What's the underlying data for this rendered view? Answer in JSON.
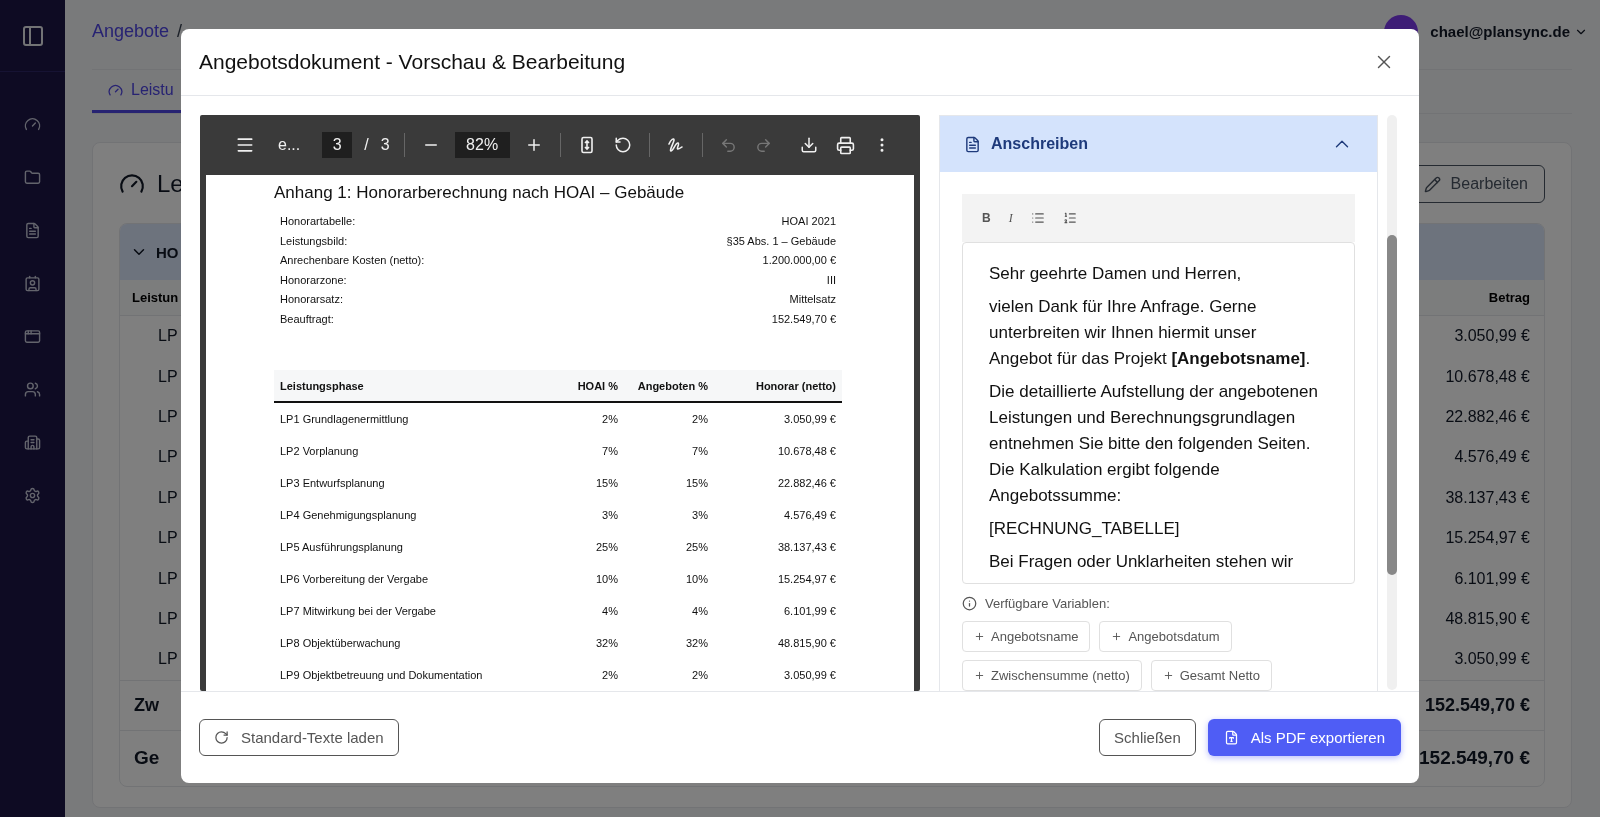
{
  "header": {
    "breadcrumb": "Angebote",
    "breadcrumb_separator": "/",
    "user_email": "chael@plansync.de"
  },
  "tabs": [
    {
      "label": "Leistu",
      "selected": true
    }
  ],
  "card": {
    "title": "Le",
    "edit_button": "Bearbeiten",
    "group": {
      "label": "HO",
      "expanded": true
    },
    "columns": [
      "Leistun",
      "Betrag"
    ],
    "rows": [
      {
        "phase": "LP",
        "amount": "3.050,99 €"
      },
      {
        "phase": "LP",
        "amount": "10.678,48 €"
      },
      {
        "phase": "LP",
        "amount": "22.882,46 €"
      },
      {
        "phase": "LP",
        "amount": "4.576,49 €"
      },
      {
        "phase": "LP",
        "amount": "38.137,43 €"
      },
      {
        "phase": "LP",
        "amount": "15.254,97 €"
      },
      {
        "phase": "LP",
        "amount": "6.101,99 €"
      },
      {
        "phase": "LP",
        "amount": "48.815,90 €"
      },
      {
        "phase": "LP",
        "amount": "3.050,99 €"
      }
    ],
    "subtotal": {
      "label": "Zw",
      "amount": "152.549,70 €"
    },
    "total": {
      "label": "Ge",
      "amount": "152.549,70 €"
    }
  },
  "dialog": {
    "title": "Angebotsdokument - Vorschau & Bearbeitung",
    "pdf_viewer": {
      "toolbar": {
        "document_name": "e...",
        "page": "3",
        "page_separator": "/",
        "page_count": "3",
        "zoom": "82%",
        "undo_disabled": true,
        "redo_disabled": true
      },
      "page": {
        "title": "Anhang 1: Honorarberechnung nach HOAI – Gebäude",
        "info": [
          {
            "label": "Honorartabelle:",
            "value": "HOAI 2021"
          },
          {
            "label": "Leistungsbild:",
            "value": "§35 Abs. 1 – Gebäude"
          },
          {
            "label": "Anrechenbare Kosten (netto):",
            "value": "1.200.000,00 €"
          },
          {
            "label": "Honorarzone:",
            "value": "III"
          },
          {
            "label": "Honorarsatz:",
            "value": "Mittelsatz"
          },
          {
            "label": "Beauftragt:",
            "value": "152.549,70 €"
          }
        ],
        "columns": [
          "Leistungsphase",
          "HOAI %",
          "Angeboten %",
          "Honorar (netto)"
        ],
        "rows": [
          [
            "LP1 Grundlagenermittlung",
            "2%",
            "2%",
            "3.050,99 €"
          ],
          [
            "LP2 Vorplanung",
            "7%",
            "7%",
            "10.678,48 €"
          ],
          [
            "LP3 Entwurfsplanung",
            "15%",
            "15%",
            "22.882,46 €"
          ],
          [
            "LP4 Genehmigungsplanung",
            "3%",
            "3%",
            "4.576,49 €"
          ],
          [
            "LP5 Ausführungsplanung",
            "25%",
            "25%",
            "38.137,43 €"
          ],
          [
            "LP6 Vorbereitung der Vergabe",
            "10%",
            "10%",
            "15.254,97 €"
          ],
          [
            "LP7 Mitwirkung bei der Vergabe",
            "4%",
            "4%",
            "6.101,99 €"
          ],
          [
            "LP8 Objektüberwachung",
            "32%",
            "32%",
            "48.815,90 €"
          ],
          [
            "LP9 Objektbetreuung und Dokumentation",
            "2%",
            "2%",
            "3.050,99 €"
          ]
        ]
      }
    },
    "editor": {
      "section_title": "Anschreiben",
      "expanded": true,
      "bold_button": "B",
      "italic_button": "I",
      "paragraphs": [
        "Sehr geehrte Damen und Herren,",
        "vielen Dank für Ihre Anfrage. Gerne unterbreiten wir Ihnen hiermit unser Angebot für das Projekt **[Angebotsname]**.",
        "Die detaillierte Aufstellung der angebotenen Leistungen und Berechnungsgrundlagen entnehmen Sie bitte den folgenden Seiten. Die Kalkulation ergibt folgende Angebotssumme:",
        "[RECHNUNG_TABELLE]",
        "Bei Fragen oder Unklarheiten stehen wir"
      ],
      "variables_label": "Verfügbare Variablen:",
      "variables": [
        "Angebotsname",
        "Angebotsdatum",
        "Zwischensumme (netto)",
        "Gesamt Netto"
      ]
    },
    "footer": {
      "reset_button": "Standard-Texte laden",
      "close_button": "Schließen",
      "export_button": "Als PDF exportieren"
    }
  }
}
